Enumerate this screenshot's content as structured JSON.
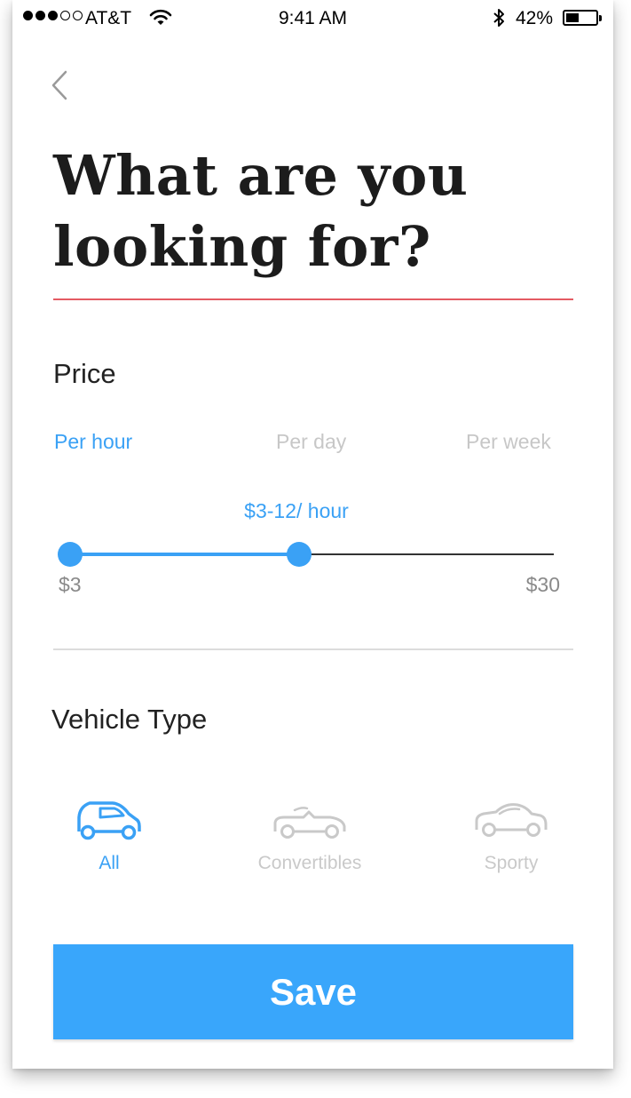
{
  "status_bar": {
    "carrier": "AT&T",
    "time": "9:41 AM",
    "battery_percent": "42%",
    "signal_bars_filled": 3,
    "signal_bars_total": 5,
    "icons": [
      "wifi-icon",
      "bluetooth-icon",
      "battery-icon"
    ]
  },
  "nav": {
    "back_icon": "chevron-left-icon"
  },
  "header": {
    "title_line1": "What are you",
    "title_line2": "looking for?"
  },
  "price": {
    "label": "Price",
    "tabs": [
      {
        "label": "Per hour",
        "active": true
      },
      {
        "label": "Per day",
        "active": false
      },
      {
        "label": "Per week",
        "active": false
      }
    ],
    "range_text": "$3-12/ hour",
    "min_label": "$3",
    "max_label": "$30",
    "min_value": 3,
    "max_value": 30,
    "selected_min": 3,
    "selected_max": 12
  },
  "vehicle": {
    "label": "Vehicle Type",
    "options": [
      {
        "label": "All",
        "icon": "hatchback-car-icon",
        "active": true
      },
      {
        "label": "Convertibles",
        "icon": "convertible-car-icon",
        "active": false
      },
      {
        "label": "Sporty",
        "icon": "sports-car-icon",
        "active": false
      }
    ]
  },
  "save_button": {
    "label": "Save"
  },
  "colors": {
    "accent": "#39a6fb",
    "title_rule": "#e45b63",
    "inactive": "#c7c7c7"
  }
}
